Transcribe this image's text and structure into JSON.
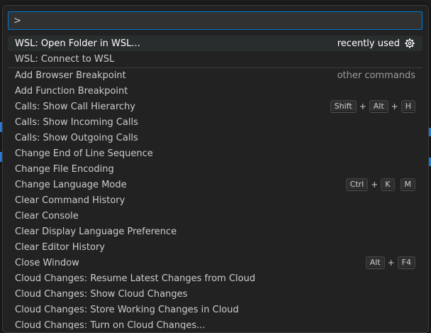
{
  "colors": {
    "accent": "#0078d4",
    "palette_bg": "#222222",
    "active_row_bg": "#2a2d2e",
    "text": "#cccccc",
    "muted": "#9d9d9d"
  },
  "search": {
    "value": ">"
  },
  "recent": [
    {
      "label": "WSL: Open Folder in WSL...",
      "meta": "recently used",
      "icon": "gear-icon"
    },
    {
      "label": "WSL: Connect to WSL"
    }
  ],
  "other_meta": "other commands",
  "commands": [
    {
      "label": "Add Browser Breakpoint"
    },
    {
      "label": "Add Function Breakpoint"
    },
    {
      "label": "Calls: Show Call Hierarchy",
      "keys": [
        [
          "Shift",
          "Alt",
          "H"
        ]
      ]
    },
    {
      "label": "Calls: Show Incoming Calls"
    },
    {
      "label": "Calls: Show Outgoing Calls"
    },
    {
      "label": "Change End of Line Sequence"
    },
    {
      "label": "Change File Encoding"
    },
    {
      "label": "Change Language Mode",
      "keys": [
        [
          "Ctrl",
          "K"
        ],
        [
          "M"
        ]
      ]
    },
    {
      "label": "Clear Command History"
    },
    {
      "label": "Clear Console"
    },
    {
      "label": "Clear Display Language Preference"
    },
    {
      "label": "Clear Editor History"
    },
    {
      "label": "Close Window",
      "keys": [
        [
          "Alt",
          "F4"
        ]
      ]
    },
    {
      "label": "Cloud Changes: Resume Latest Changes from Cloud"
    },
    {
      "label": "Cloud Changes: Show Cloud Changes"
    },
    {
      "label": "Cloud Changes: Store Working Changes in Cloud"
    },
    {
      "label": "Cloud Changes: Turn on Cloud Changes..."
    }
  ]
}
